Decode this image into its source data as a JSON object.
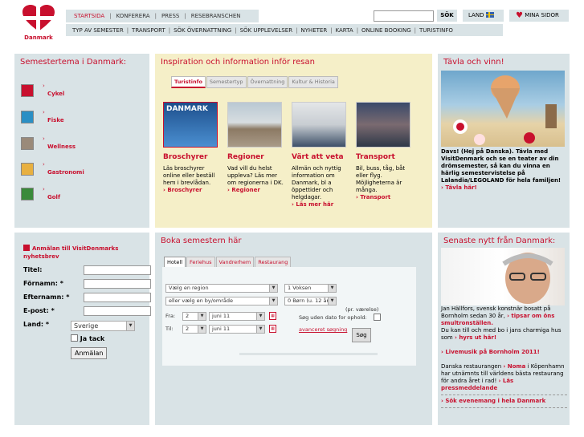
{
  "logo": {
    "text": "Danmark"
  },
  "topnav": [
    "STARTSIDA",
    "KONFERERA",
    "PRESS",
    "RESEBRANSCHEN"
  ],
  "subnav": [
    "TYP AV SEMESTER",
    "TRANSPORT",
    "SÖK ÖVERNATTNING",
    "SÖK UPPLEVELSER",
    "NYHETER",
    "KARTA",
    "ONLINE BOOKING",
    "TURISTINFO"
  ],
  "search": {
    "button": "SÖK",
    "value": ""
  },
  "land": "LAND",
  "mina": "MINA SIDOR",
  "tema": {
    "title": "Semestertema i Danmark:",
    "items": [
      "Cykel",
      "Fiske",
      "Wellness",
      "Gastronomi",
      "Golf"
    ]
  },
  "insp": {
    "title": "Inspiration och information inför resan",
    "tabs": [
      "Turistinfo",
      "Semestertyp",
      "Övernattning",
      "Kultur & Historia"
    ],
    "cards": [
      {
        "title": "Broschyrer",
        "body": "Läs broschyrer online eller beställ hem i brevlådan.",
        "link": "Broschyrer",
        "img_text": "DANMARK"
      },
      {
        "title": "Regioner",
        "body": "Vad vill du helst uppleva? Läs mer om regionerna i DK.",
        "link": "Regioner"
      },
      {
        "title": "Värt att veta",
        "body": "Allmän och nyttig information om Danmark, bl a öppettider och helgdagar.",
        "link": "Läs mer här"
      },
      {
        "title": "Transport",
        "body": "Bil, buss, tåg, båt eller flyg. Möjligheterna är många.",
        "link": "Transport"
      }
    ]
  },
  "tavla": {
    "title": "Tävla och vinn!",
    "text": "Davs! (Hej på Danska). Tävla med VisitDenmark och se en teater av din drömsemester, så kan du vinna en härlig semestervistelse på Lalandia/LEGOLAND för hela familjen!",
    "link": "Tävla här!"
  },
  "anm": {
    "heading": "Anmälan till VisitDenmarks nyhetsbrev",
    "fields": [
      "Titel:",
      "Förnamn:",
      "Efternamn:",
      "E-post:",
      "Land:"
    ],
    "country": "Sverige",
    "consent": "Ja tack",
    "submit": "Anmälan"
  },
  "boka": {
    "title": "Boka semestern här",
    "tabs": [
      "Hotell",
      "Feriehus",
      "Vandrerhem",
      "Restaurang"
    ],
    "region": "Vælg en region",
    "city": "eller vælg en by/område",
    "adults": "1 Voksen",
    "children": "0 Børn (u. 12 år)",
    "per_room": "(pr. værelse)",
    "fra_label": "Fra:",
    "til_label": "Til:",
    "fra_day": "2",
    "fra_month": "juni 11",
    "til_day": "2",
    "til_month": "juni 11",
    "nodate": "Søg uden dato for ophold:",
    "advanced": "avanceret søgning",
    "search": "Søg"
  },
  "nytt": {
    "title": "Senaste nytt från Danmark:",
    "p1": "Jan Hällfors, svensk konstnär bosatt på Bornholm sedan 30 år,",
    "p1link": "tipsar om öns smultronställen.",
    "p1b": "Du kan till och med bo i jans charmiga hus som",
    "p1blink": "hyrs ut här!",
    "p2link": "Livemusik på Bornholm 2011!",
    "p3": "Danska restaurangen",
    "p3name": "Noma",
    "p3b": "i Köpenhamn har utnämnts till världens bästa restaurang för andra året i rad!",
    "p3link": "Läs pressmeddelande",
    "p4link": "Sök evenemang i hela Danmark"
  },
  "colors": {
    "accent": "#c8102e",
    "panel": "#d9e3e6",
    "insp_bg": "#f5efc8"
  }
}
